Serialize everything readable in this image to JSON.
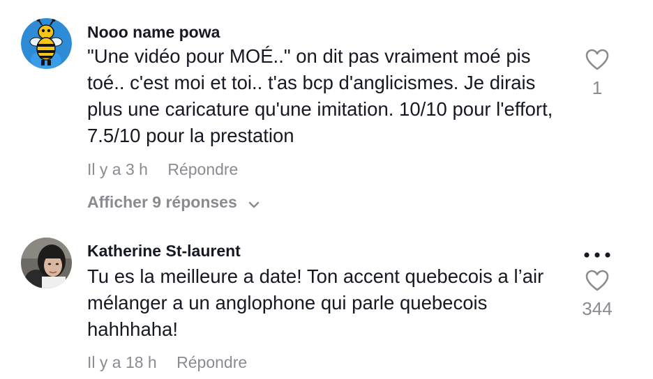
{
  "comments": [
    {
      "username": "Nooo name powa",
      "text": "\"Une vidéo pour MOÉ..\" on dit pas vraiment moé pis toé.. c'est moi et toi.. t'as bcp d'anglicismes. Je dirais plus une caricature qu'une imitation. 10/10 pour l'effort, 7.5/10 pour la prestation",
      "time": "Il y a 3 h",
      "reply_label": "Répondre",
      "like_count": "1",
      "view_replies": "Afficher 9 réponses",
      "icons": {
        "like": "heart-outline-icon",
        "expand": "chevron-down-icon"
      }
    },
    {
      "username": "Katherine St-laurent",
      "text": "Tu es la meilleure a date! Ton accent quebecois a l’air mélanger a un anglophone qui parle quebecois hahhhaha!",
      "time": "Il y a 18 h",
      "reply_label": "Répondre",
      "like_count": "344",
      "icons": {
        "like": "heart-outline-icon",
        "more": "more-dots-icon"
      }
    }
  ],
  "colors": {
    "text_primary": "#161823",
    "text_secondary": "#8a8b91"
  }
}
